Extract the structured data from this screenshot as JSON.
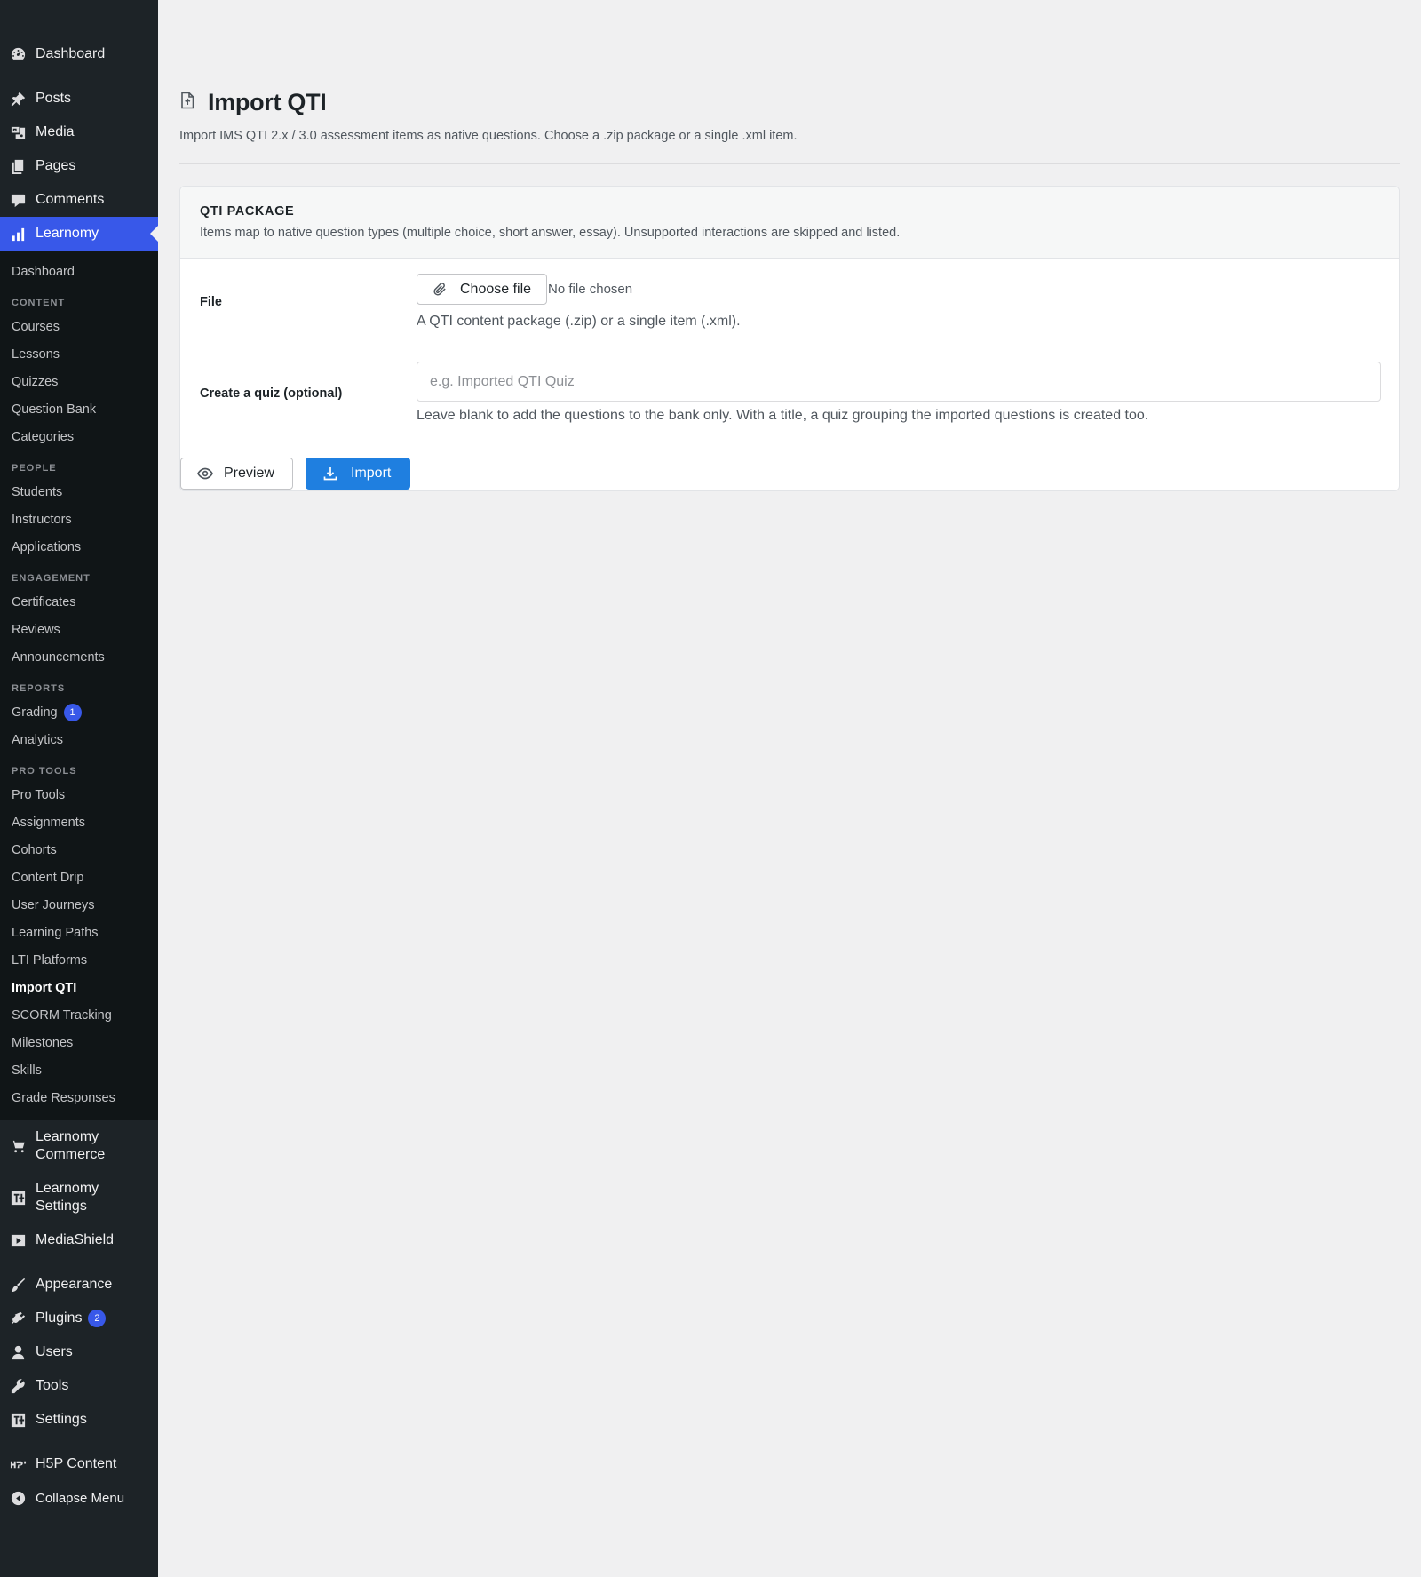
{
  "sidebar": {
    "top_items": [
      {
        "label": "Dashboard",
        "icon": "dashboard-icon"
      },
      {
        "label": "Posts",
        "icon": "pin-icon"
      },
      {
        "label": "Media",
        "icon": "media-icon"
      },
      {
        "label": "Pages",
        "icon": "pages-icon"
      },
      {
        "label": "Comments",
        "icon": "comments-icon"
      },
      {
        "label": "Learnomy",
        "icon": "chart-bars-icon"
      }
    ],
    "sub": {
      "dashboard": "Dashboard",
      "content_head": "CONTENT",
      "courses": "Courses",
      "lessons": "Lessons",
      "quizzes": "Quizzes",
      "question_bank": "Question Bank",
      "categories": "Categories",
      "people_head": "PEOPLE",
      "students": "Students",
      "instructors": "Instructors",
      "applications": "Applications",
      "engagement_head": "ENGAGEMENT",
      "certificates": "Certificates",
      "reviews": "Reviews",
      "announcements": "Announcements",
      "reports_head": "REPORTS",
      "grading": "Grading",
      "grading_badge": "1",
      "analytics": "Analytics",
      "protools_head": "PRO TOOLS",
      "pro_tools": "Pro Tools",
      "assignments": "Assignments",
      "cohorts": "Cohorts",
      "content_drip": "Content Drip",
      "user_journeys": "User Journeys",
      "learning_paths": "Learning Paths",
      "lti_platforms": "LTI Platforms",
      "import_qti": "Import QTI",
      "scorm_tracking": "SCORM Tracking",
      "milestones": "Milestones",
      "skills": "Skills",
      "grade_responses": "Grade Responses"
    },
    "bottom": {
      "commerce_1": "Learnomy",
      "commerce_2": "Commerce",
      "settings_1": "Learnomy",
      "settings_2": "Settings",
      "mediashield": "MediaShield",
      "appearance": "Appearance",
      "plugins": "Plugins",
      "plugins_badge": "2",
      "users": "Users",
      "tools": "Tools",
      "settings": "Settings",
      "h5p": "H5P Content",
      "collapse": "Collapse Menu"
    },
    "active_color": "#3858e9",
    "background_color": "#1d2327"
  },
  "page": {
    "title": "Import QTI",
    "title_icon": "file-upload-icon",
    "subtitle": "Import IMS QTI 2.x / 3.0 assessment items as native questions. Choose a .zip package or a single .xml item."
  },
  "card": {
    "title": "QTI PACKAGE",
    "description": "Items map to native question types (multiple choice, short answer, essay). Unsupported interactions are skipped and listed.",
    "file": {
      "label": "File",
      "button": "Choose file",
      "status": "No file chosen",
      "help": "A QTI content package (.zip) or a single item (.xml)."
    },
    "quiz": {
      "label": "Create a quiz (optional)",
      "placeholder": "e.g. Imported QTI Quiz",
      "value": "",
      "help": "Leave blank to add the questions to the bank only. With a title, a quiz grouping the imported questions is created too."
    },
    "actions": {
      "preview": "Preview",
      "import": "Import"
    }
  },
  "colors": {
    "primary_button": "#1f7fe0",
    "page_background": "#f0f0f1"
  }
}
